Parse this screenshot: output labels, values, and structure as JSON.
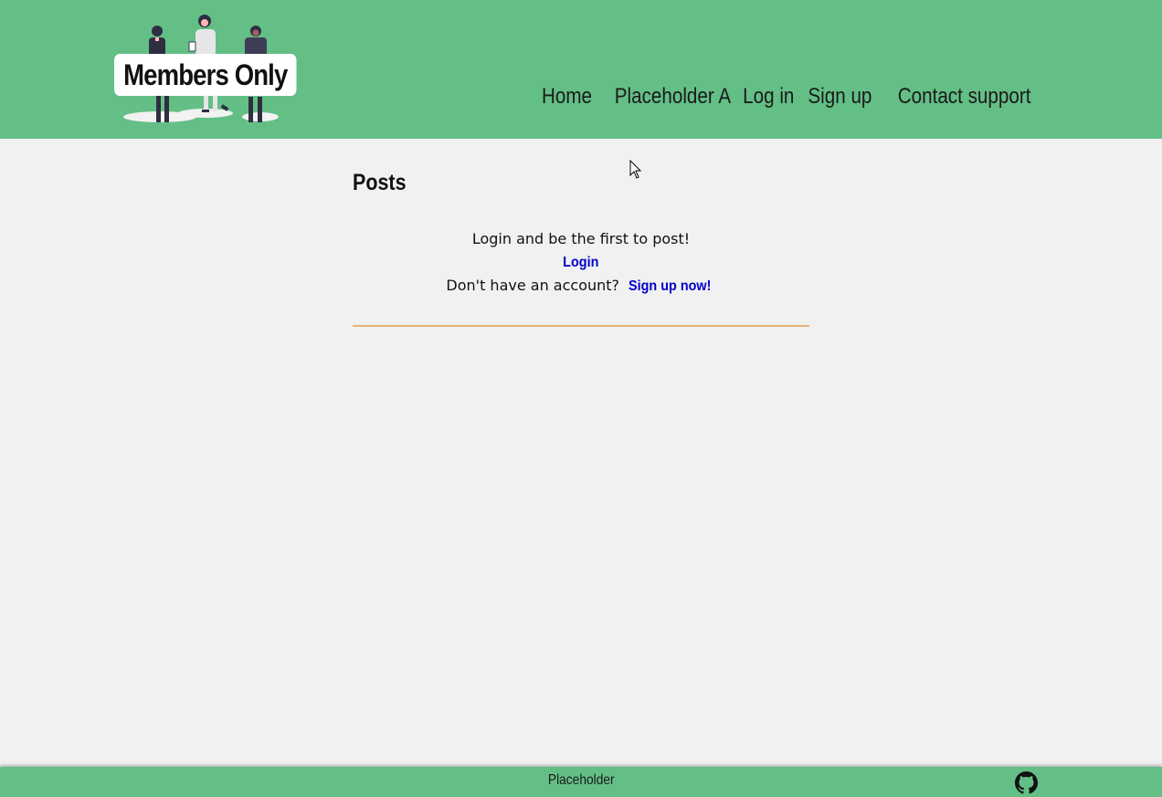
{
  "header": {
    "logo_text": "Members Only",
    "nav": [
      {
        "label": "Home"
      },
      {
        "label": "Placeholder A"
      },
      {
        "label": "Log in"
      },
      {
        "label": "Sign up"
      },
      {
        "label": "Contact support"
      }
    ]
  },
  "main": {
    "heading": "Posts",
    "empty_message": "Login and be the first to post!",
    "login_link": "Login",
    "signup_prompt": "Don't have an account?",
    "signup_link": "Sign up now!"
  },
  "footer": {
    "text": "Placeholder",
    "github_icon": "github-icon"
  },
  "colors": {
    "header_bg": "#63bf85",
    "page_bg": "#f1f1f1",
    "link": "#0000cc",
    "divider": "#e3b772"
  }
}
